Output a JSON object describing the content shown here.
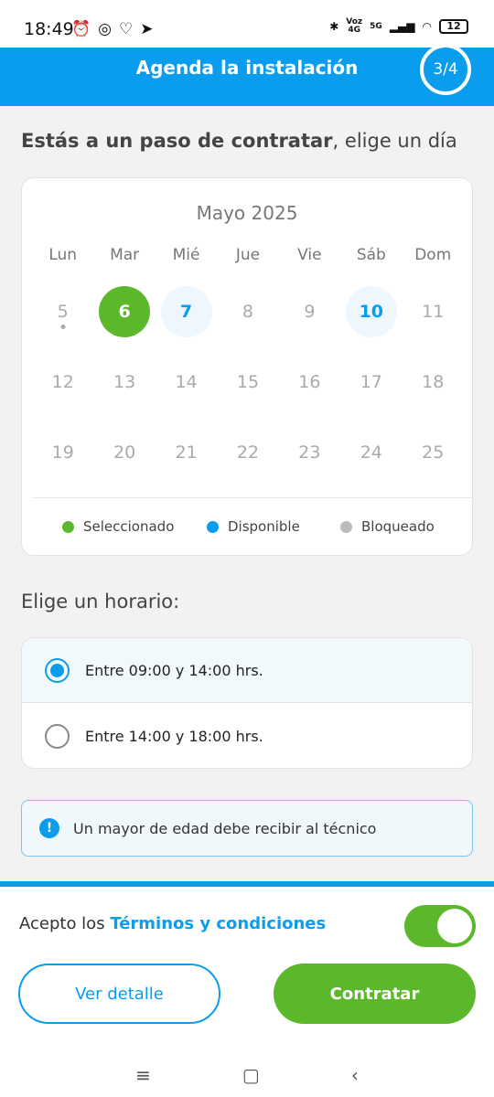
{
  "status_bar": {
    "time": "18:49",
    "left_icons": [
      "alarm-icon",
      "instagram-icon",
      "app-icon",
      "telegram-icon"
    ],
    "right_icons": [
      "bluetooth-icon",
      "signal-icon",
      "wifi-icon"
    ],
    "voz_label": "Voz",
    "net_4g": "4G",
    "net_5g": "5G",
    "battery": "12"
  },
  "header": {
    "title": "Agenda la instalación",
    "step": "3/4"
  },
  "intro": {
    "bold": "Estás a un paso de contratar",
    "rest": ", elige un día"
  },
  "calendar": {
    "month": "Mayo 2025",
    "weekdays": [
      "Lun",
      "Mar",
      "Mié",
      "Jue",
      "Vie",
      "Sáb",
      "Dom"
    ],
    "weeks": [
      [
        {
          "day": "5",
          "state": "blocked",
          "today": true
        },
        {
          "day": "6",
          "state": "selected"
        },
        {
          "day": "7",
          "state": "available"
        },
        {
          "day": "8",
          "state": "blocked"
        },
        {
          "day": "9",
          "state": "blocked"
        },
        {
          "day": "10",
          "state": "available"
        },
        {
          "day": "11",
          "state": "blocked"
        }
      ],
      [
        {
          "day": "12",
          "state": "blocked"
        },
        {
          "day": "13",
          "state": "blocked"
        },
        {
          "day": "14",
          "state": "blocked"
        },
        {
          "day": "15",
          "state": "blocked"
        },
        {
          "day": "16",
          "state": "blocked"
        },
        {
          "day": "17",
          "state": "blocked"
        },
        {
          "day": "18",
          "state": "blocked"
        }
      ],
      [
        {
          "day": "19",
          "state": "blocked"
        },
        {
          "day": "20",
          "state": "blocked"
        },
        {
          "day": "21",
          "state": "blocked"
        },
        {
          "day": "22",
          "state": "blocked"
        },
        {
          "day": "23",
          "state": "blocked"
        },
        {
          "day": "24",
          "state": "blocked"
        },
        {
          "day": "25",
          "state": "blocked"
        }
      ]
    ],
    "legend": {
      "selected": "Seleccionado",
      "available": "Disponible",
      "blocked": "Bloqueado"
    },
    "colors": {
      "selected": "#5cb82b",
      "available": "#0b9ded",
      "blocked": "#bbbbbb"
    }
  },
  "horario": {
    "label": "Elige un horario:",
    "options": [
      {
        "label": "Entre 09:00 y 14:00 hrs.",
        "selected": true
      },
      {
        "label": "Entre 14:00 y 18:00 hrs.",
        "selected": false
      }
    ]
  },
  "notice": {
    "icon": "info-icon",
    "text": "Un mayor de edad debe recibir al técnico"
  },
  "footer": {
    "terms_prefix": "Acepto los ",
    "terms_link": "Términos y condiciones",
    "terms_accepted": true,
    "detail_button": "Ver detalle",
    "contract_button": "Contratar"
  },
  "nav": {
    "menu_icon": "≡",
    "home_icon": "▢",
    "back_icon": "‹"
  }
}
